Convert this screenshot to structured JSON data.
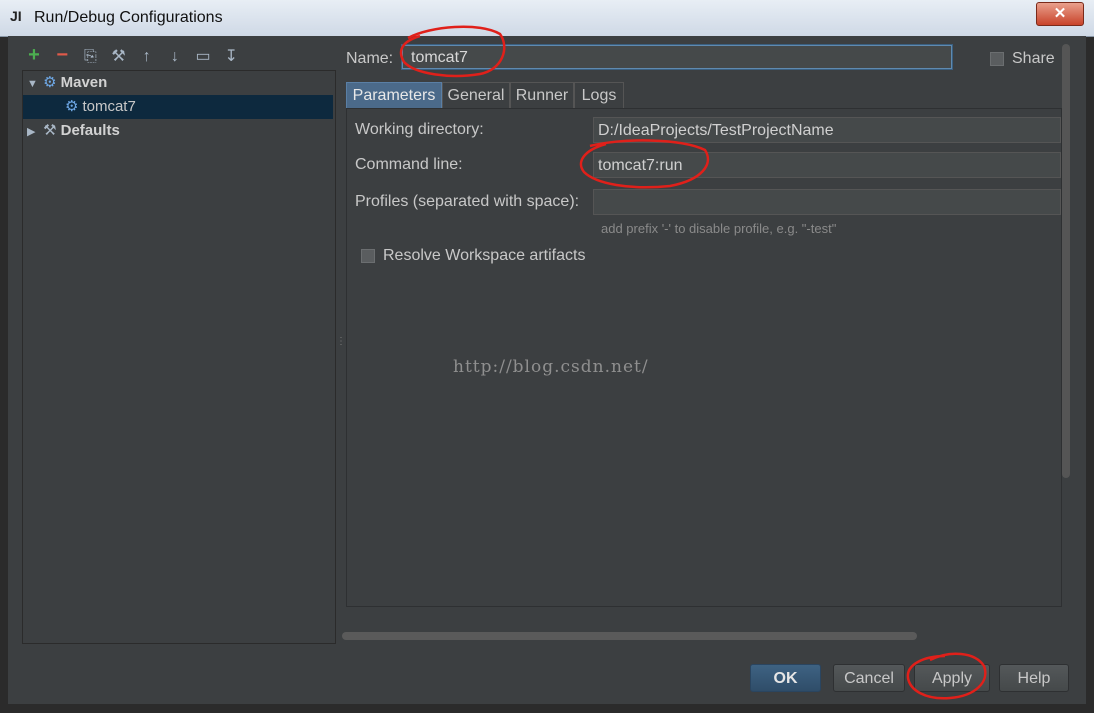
{
  "window": {
    "app_icon": "JI",
    "title": "Run/Debug Configurations",
    "close": "✕"
  },
  "toolbar": {
    "icons": [
      "+",
      "−",
      "⎘",
      "⚒",
      "↑",
      "↓",
      "▭",
      "↧"
    ]
  },
  "tree": {
    "maven": "Maven",
    "tomcat7": "tomcat7",
    "defaults": "Defaults"
  },
  "form": {
    "name_label": "Name:",
    "name_value": "tomcat7",
    "share_label": "Share",
    "tabs": [
      "Parameters",
      "General",
      "Runner",
      "Logs"
    ],
    "working_dir_label": "Working directory:",
    "working_dir_value": "D:/IdeaProjects/TestProjectName",
    "command_line_label": "Command line:",
    "command_line_value": "tomcat7:run",
    "profiles_label": "Profiles (separated with space):",
    "profiles_value": "",
    "profiles_hint": "add prefix '-' to disable profile, e.g. \"-test\"",
    "resolve_label": "Resolve Workspace artifacts"
  },
  "watermark": "http://blog.csdn.net/",
  "buttons": {
    "ok": "OK",
    "cancel": "Cancel",
    "apply": "Apply",
    "help": "Help"
  },
  "colors": {
    "annotation": "#e0201a",
    "accent": "#4b6a8a"
  }
}
